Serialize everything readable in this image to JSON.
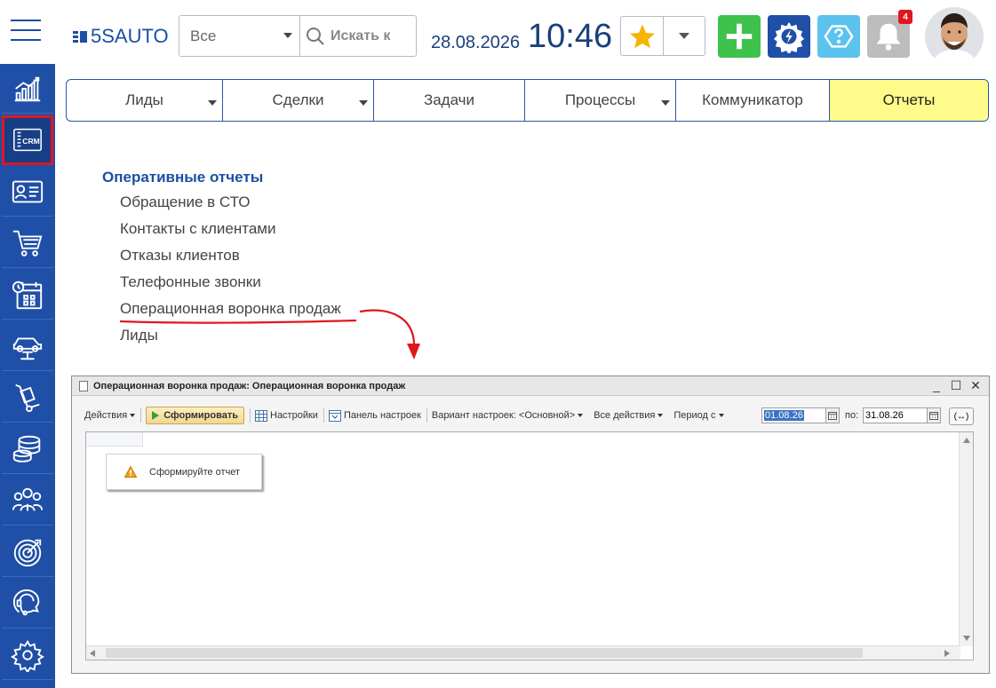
{
  "header": {
    "logo": "5SAUTO",
    "search_scope": "Все",
    "search_placeholder": "Искать к",
    "date": "28.08.2026",
    "time": "10:46",
    "notifications_count": "4"
  },
  "colors": {
    "brand": "#1f4fa6",
    "accent_add": "#3ec24b",
    "accent_help": "#5cc3ee",
    "active_tab": "#fffb8a",
    "highlight": "#e0161e"
  },
  "sidebar": {
    "items": [
      {
        "icon": "chart-growth-icon"
      },
      {
        "icon": "crm-icon",
        "label": "CRM",
        "active": true
      },
      {
        "icon": "contact-card-icon"
      },
      {
        "icon": "shopping-cart-icon"
      },
      {
        "icon": "calendar-clock-icon"
      },
      {
        "icon": "car-lift-icon"
      },
      {
        "icon": "hand-truck-icon"
      },
      {
        "icon": "database-icon"
      },
      {
        "icon": "team-icon"
      },
      {
        "icon": "target-icon"
      },
      {
        "icon": "headset-icon"
      },
      {
        "icon": "gear-icon"
      }
    ]
  },
  "nav": {
    "tabs": [
      {
        "label": "Лиды",
        "has_dropdown": true
      },
      {
        "label": "Сделки",
        "has_dropdown": true
      },
      {
        "label": "Задачи",
        "has_dropdown": false
      },
      {
        "label": "Процессы",
        "has_dropdown": true
      },
      {
        "label": "Коммуникатор",
        "has_dropdown": false
      },
      {
        "label": "Отчеты",
        "has_dropdown": false,
        "active": true
      }
    ]
  },
  "reports": {
    "section_title": "Оперативные отчеты",
    "items": [
      "Обращение в СТО",
      "Контакты с клиентами",
      "Отказы клиентов",
      "Телефонные звонки",
      "Операционная воронка продаж",
      "Лиды"
    ],
    "highlighted_item": "Операционная воронка продаж"
  },
  "report_window": {
    "title": "Операционная воронка продаж: Операционная воронка продаж",
    "toolbar": {
      "actions": "Действия",
      "run": "Сформировать",
      "settings": "Настройки",
      "settings_panel": "Панель настроек",
      "variant": "Вариант настроек: <Основной>",
      "all_actions": "Все действия",
      "period_from": "Период с"
    },
    "date_from": "01.08.26",
    "date_to_label": "по:",
    "date_to": "31.08.26",
    "period_button": "(↔)",
    "notice": "Сформируйте отчет"
  }
}
